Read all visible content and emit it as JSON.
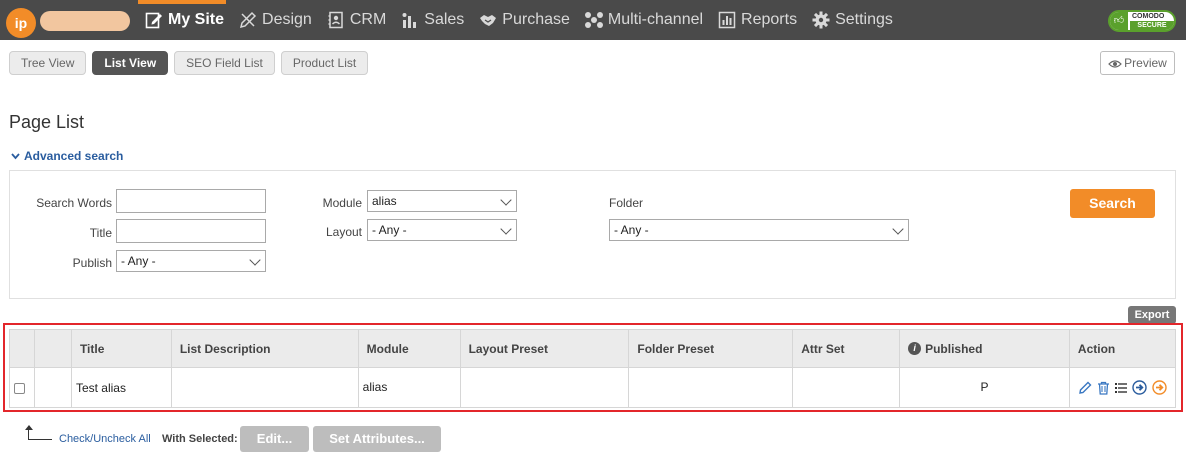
{
  "topbar": {
    "logo_text": "ip",
    "nav": [
      {
        "label": "My Site",
        "icon": "edit-page-icon",
        "active": true
      },
      {
        "label": "Design",
        "icon": "pencil-ruler-icon",
        "active": false
      },
      {
        "label": "CRM",
        "icon": "contact-card-icon",
        "active": false
      },
      {
        "label": "Sales",
        "icon": "sales-bars-icon",
        "active": false
      },
      {
        "label": "Purchase",
        "icon": "handshake-icon",
        "active": false
      },
      {
        "label": "Multi-channel",
        "icon": "network-icon",
        "active": false
      },
      {
        "label": "Reports",
        "icon": "bar-chart-icon",
        "active": false
      },
      {
        "label": "Settings",
        "icon": "gear-icon",
        "active": false
      }
    ],
    "badge": {
      "line1": "COMODO",
      "line2": "SECURE"
    }
  },
  "subtabs": [
    {
      "label": "Tree View",
      "active": false
    },
    {
      "label": "List View",
      "active": true
    },
    {
      "label": "SEO Field List",
      "active": false
    },
    {
      "label": "Product List",
      "active": false
    }
  ],
  "preview_label": "Preview",
  "page_title": "Page List",
  "advanced_search_label": "Advanced search",
  "search": {
    "search_words_label": "Search Words",
    "search_words_value": "",
    "title_label": "Title",
    "title_value": "",
    "publish_label": "Publish",
    "publish_value": "- Any -",
    "module_label": "Module",
    "module_value": "alias",
    "layout_label": "Layout",
    "layout_value": "- Any -",
    "folder_label": "Folder",
    "folder_value": "- Any -",
    "button_label": "Search"
  },
  "export_label": "Export",
  "table": {
    "headers": [
      "",
      "",
      "Title",
      "List Description",
      "Module",
      "Layout Preset",
      "Folder Preset",
      "Attr Set",
      "Published",
      "Action"
    ],
    "rows": [
      {
        "title": "Test alias",
        "list_description": "",
        "module": "alias",
        "layout_preset": "",
        "folder_preset": "",
        "attr_set": "",
        "published": "P"
      }
    ]
  },
  "bottom": {
    "check_all_label": "Check/Uncheck All",
    "with_selected_label": "With Selected:",
    "edit_label": "Edit...",
    "set_attributes_label": "Set Attributes..."
  },
  "colors": {
    "accent": "#f28c28",
    "topbar": "#4a4a4a",
    "link": "#2a5d9f",
    "highlight_box": "#e3262b"
  }
}
